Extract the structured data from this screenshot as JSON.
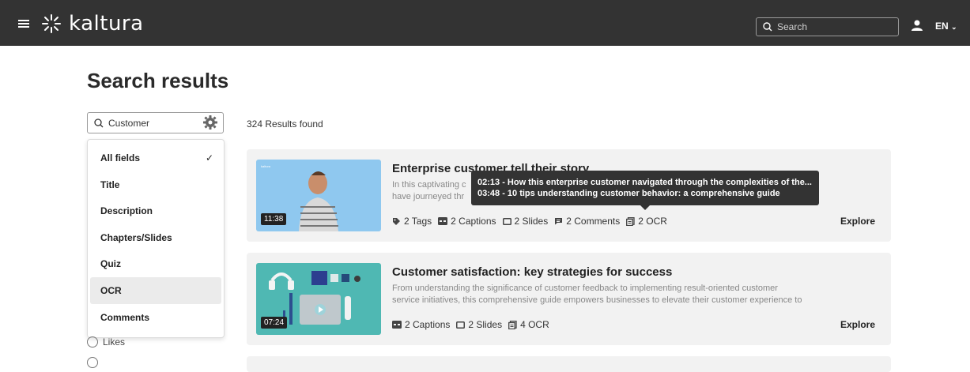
{
  "header": {
    "logo_text": "kaltura",
    "search_placeholder": "Search",
    "language": "EN",
    "bg_color": "#333333"
  },
  "page": {
    "title": "Search results"
  },
  "filter": {
    "search_value": "Customer",
    "options": [
      {
        "label": "All fields",
        "checked": true
      },
      {
        "label": "Title",
        "checked": false
      },
      {
        "label": "Description",
        "checked": false
      },
      {
        "label": "Chapters/Slides",
        "checked": false
      },
      {
        "label": "Quiz",
        "checked": false
      },
      {
        "label": "OCR",
        "checked": false,
        "hovered": true
      },
      {
        "label": "Comments",
        "checked": false
      }
    ],
    "check_mark": "✓",
    "likes_label": "Likes"
  },
  "results": {
    "count_text": "324 Results found",
    "items": [
      {
        "title": "Enterprise customer tell their story",
        "description_line1": "In this captivating c",
        "description_line1_end": "o",
        "description_line2": "have journeyed thr",
        "duration": "11:38",
        "meta": [
          "2 Tags",
          "2 Captions",
          "2 Slides",
          "2 Comments",
          "2 OCR"
        ],
        "explore": "Explore"
      },
      {
        "title": "Customer satisfaction: key strategies for success",
        "description_line1": "From understanding the significance of customer feedback to implementing result-oriented customer",
        "description_line2": "service initiatives, this comprehensive guide empowers businesses to elevate their customer experience to",
        "duration": "07:24",
        "meta": [
          "2 Captions",
          "2 Slides",
          "4 OCR"
        ],
        "explore": "Explore"
      }
    ]
  },
  "tooltip": {
    "line1": "02:13 - How this enterprise customer navigated through the complexities of the...",
    "line2": "03:48 - 10 tips understanding customer behavior: a comprehensive guide"
  },
  "icons": {
    "menu": "hamburger-icon",
    "search": "search-icon",
    "user": "user-icon",
    "settings": "gear-icon",
    "tag": "tag-icon",
    "captions": "captions-icon",
    "slides": "slides-icon",
    "comments": "comment-icon",
    "ocr": "ocr-icon"
  }
}
